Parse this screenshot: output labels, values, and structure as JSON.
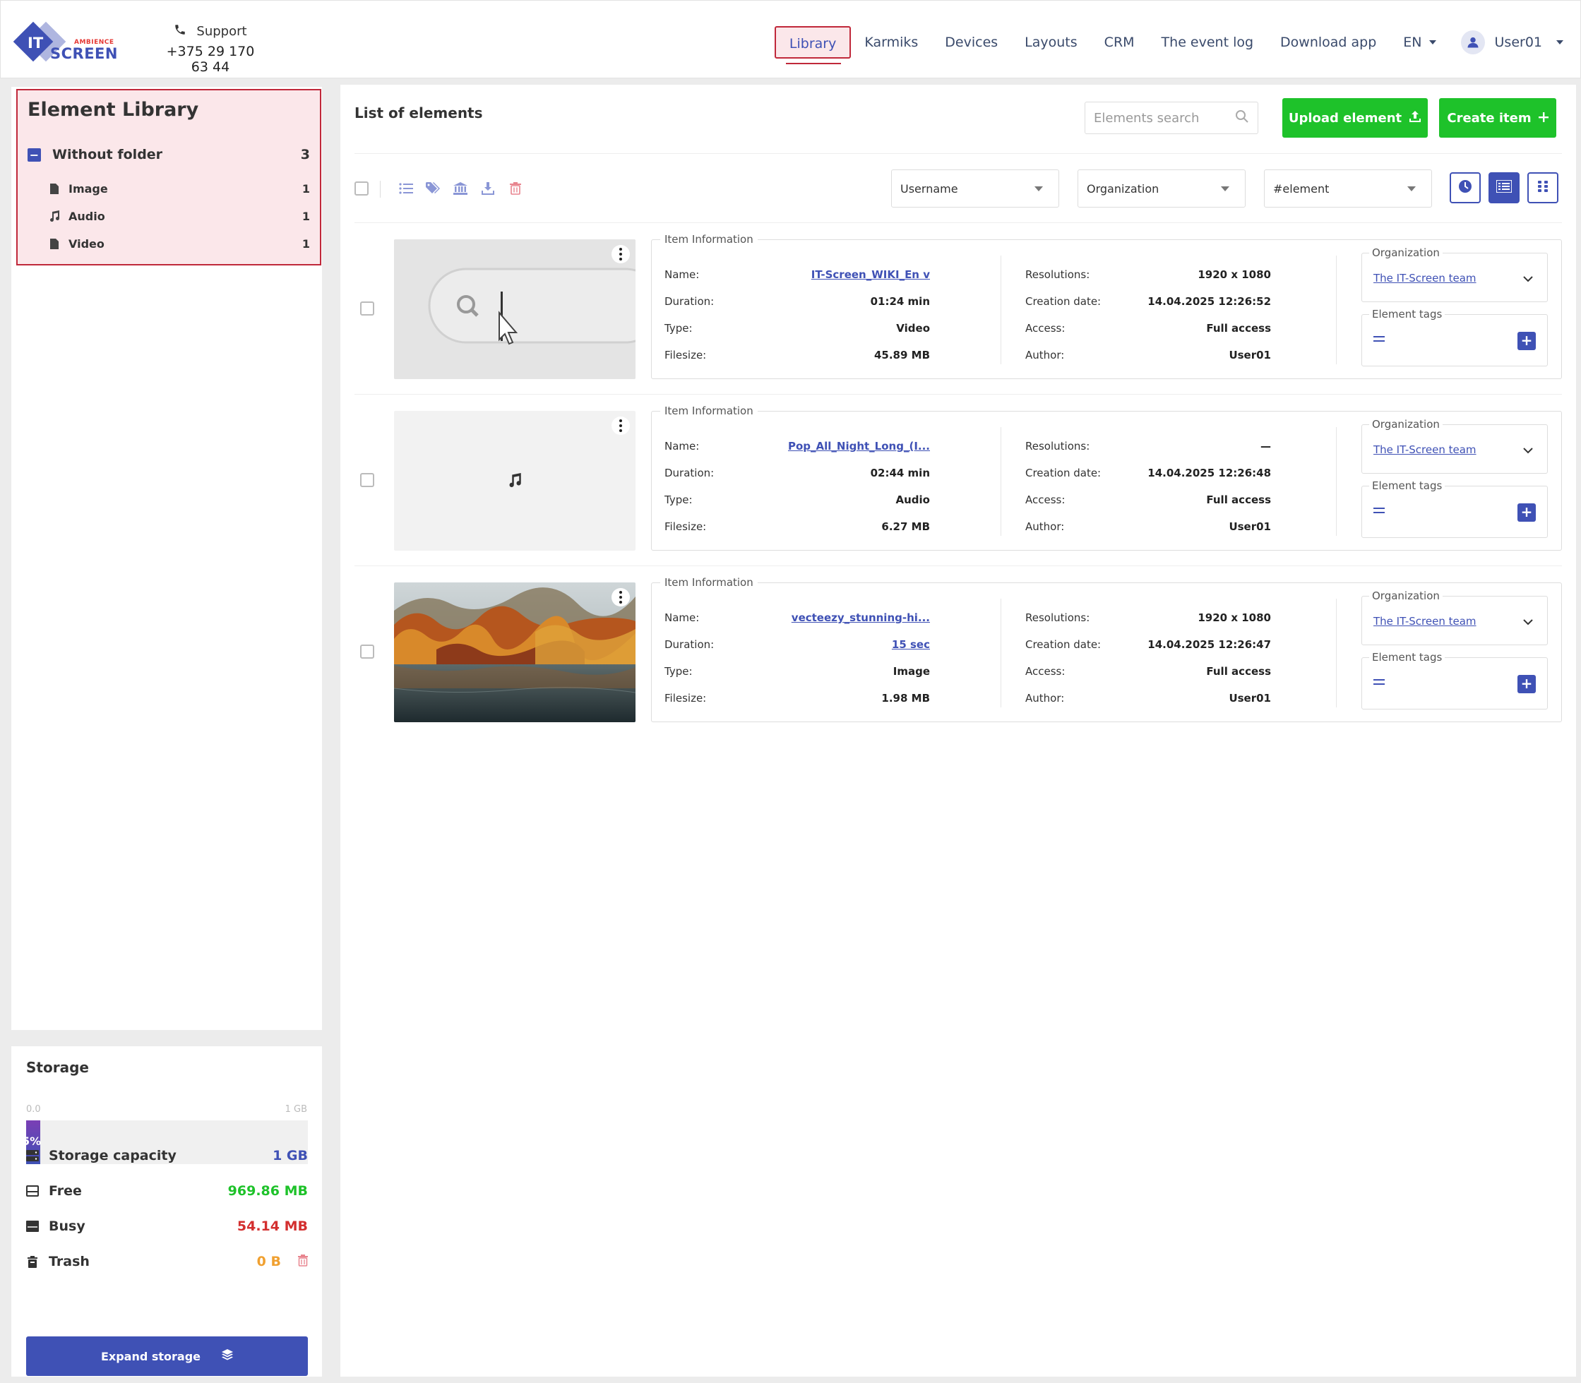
{
  "header": {
    "logo": {
      "it": "IT",
      "ambience": "AMBIENCE",
      "screen": "SCREEN"
    },
    "support_label": "Support",
    "support_phone": "+375 29 170 63 44",
    "nav": [
      "Library",
      "Karmiks",
      "Devices",
      "Layouts",
      "CRM",
      "The event log",
      "Download app"
    ],
    "active_nav": "Library",
    "language": "EN",
    "user": "User01"
  },
  "library": {
    "title": "Element Library",
    "folder": {
      "label": "Without folder",
      "count": "3"
    },
    "items": [
      {
        "label": "Image",
        "count": "1",
        "icon": "file-icon"
      },
      {
        "label": "Audio",
        "count": "1",
        "icon": "music-icon"
      },
      {
        "label": "Video",
        "count": "1",
        "icon": "file-icon"
      }
    ]
  },
  "storage": {
    "title": "Storage",
    "scale_min": "0.0",
    "scale_max": "1 GB",
    "used_percent": 5,
    "used_label": "5%",
    "capacity_label": "Storage capacity",
    "capacity_value": "1 GB",
    "free_label": "Free",
    "free_value": "969.86 MB",
    "busy_label": "Busy",
    "busy_value": "54.14 MB",
    "trash_label": "Trash",
    "trash_value": "0 B",
    "expand_label": "Expand storage",
    "colors": {
      "capacity": "#3f51b5",
      "free": "#1ec22a",
      "busy": "#d32f2f",
      "trash": "#f0a030"
    }
  },
  "main": {
    "title": "List of elements",
    "search_placeholder": "Elements search",
    "upload_label": "Upload element",
    "create_label": "Create item",
    "filters": {
      "username": "Username",
      "organization": "Organization",
      "tag": "#element"
    }
  },
  "labels": {
    "item_information": "Item Information",
    "name": "Name:",
    "duration": "Duration:",
    "type": "Type:",
    "filesize": "Filesize:",
    "resolutions": "Resolutions:",
    "creation_date": "Creation date:",
    "access": "Access:",
    "author": "Author:",
    "organization": "Organization",
    "element_tags": "Element tags"
  },
  "elements": [
    {
      "name": "IT-Screen_WIKI_En v",
      "duration": "01:24 min",
      "type": "Video",
      "filesize": "45.89 MB",
      "resolution": "1920 x 1080",
      "creation_date": "14.04.2025 12:26:52",
      "access": "Full access",
      "author": "User01",
      "organization": "The IT-Screen team",
      "thumb": "search-bar-video-thumbnail"
    },
    {
      "name": "Pop_All_Night_Long_(I...",
      "duration": "02:44 min",
      "type": "Audio",
      "filesize": "6.27 MB",
      "resolution": "—",
      "creation_date": "14.04.2025 12:26:48",
      "access": "Full access",
      "author": "User01",
      "organization": "The IT-Screen team",
      "thumb": "music-note-icon"
    },
    {
      "name": "vecteezy_stunning-hi...",
      "duration": "15 sec",
      "type": "Image",
      "filesize": "1.98 MB",
      "resolution": "1920 x 1080",
      "creation_date": "14.04.2025 12:26:47",
      "access": "Full access",
      "author": "User01",
      "organization": "The IT-Screen team",
      "thumb": "autumn-lake-photo"
    }
  ]
}
